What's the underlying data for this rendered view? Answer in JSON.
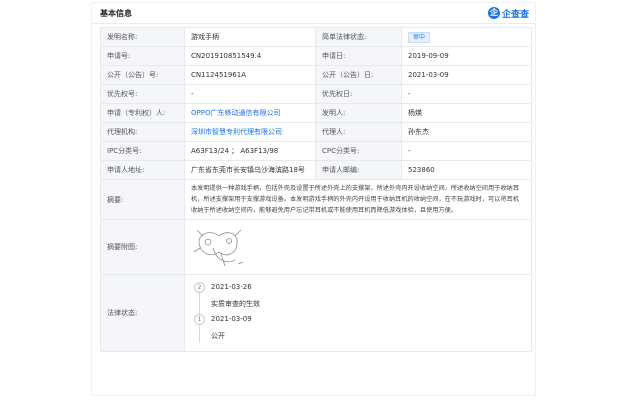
{
  "header": {
    "title": "基本信息",
    "logo_mark": "企",
    "logo_text": "企查查"
  },
  "rows": {
    "invention_name_label": "发明名称:",
    "invention_name": "游戏手柄",
    "legal_status_label": "简单法律状态:",
    "legal_status_badge": "审中",
    "app_no_label": "申请号:",
    "app_no": "CN201910851549.4",
    "app_date_label": "申请日:",
    "app_date": "2019-09-09",
    "pub_no_label": "公开（公告）号:",
    "pub_no": "CN112451961A",
    "pub_date_label": "公开（公告）日:",
    "pub_date": "2021-03-09",
    "priority_no_label": "优先权号:",
    "priority_no": "-",
    "priority_date_label": "优先权日:",
    "priority_date": "-",
    "applicant_label": "申请（专利权）人:",
    "applicant": "OPPO广东移动通信有限公司",
    "inventor_label": "发明人:",
    "inventor": "杨煐",
    "agency_label": "代理机构:",
    "agency": "深圳市智慧专利代理有限公司",
    "agent_label": "代理人:",
    "agent": "孙东杰",
    "ipc_label": "IPC分类号:",
    "ipc": "A63F13/24 ； A63F13/98",
    "cpc_label": "CPC分类号:",
    "cpc": "-",
    "address_label": "申请人地址:",
    "address": "广东省东莞市长安镇乌沙海滨路18号",
    "postcode_label": "申请人邮编:",
    "postcode": "523860",
    "abstract_label": "摘要:",
    "abstract": "本发明提供一种游戏手柄，包括外壳及设置于所述外壳上的支撑架，所述外壳内开设收纳空间，所述收纳空间用于收纳耳机，所述支撑架用于支撑游戏设备。本发明游戏手柄的外壳内开设用于收纳耳机的收纳空间，在不玩游戏时，可以将耳机收纳于所述收纳空间内，能够避免用户忘记带耳机或不能使用耳机而降低游戏体验，且使用方便。",
    "drawing_label": "摘要附图:",
    "law_label": "法律状态:"
  },
  "timeline": [
    {
      "num": "2",
      "date": "2021-03-26",
      "event": "实质审查的生效"
    },
    {
      "num": "1",
      "date": "2021-03-09",
      "event": "公开"
    }
  ]
}
